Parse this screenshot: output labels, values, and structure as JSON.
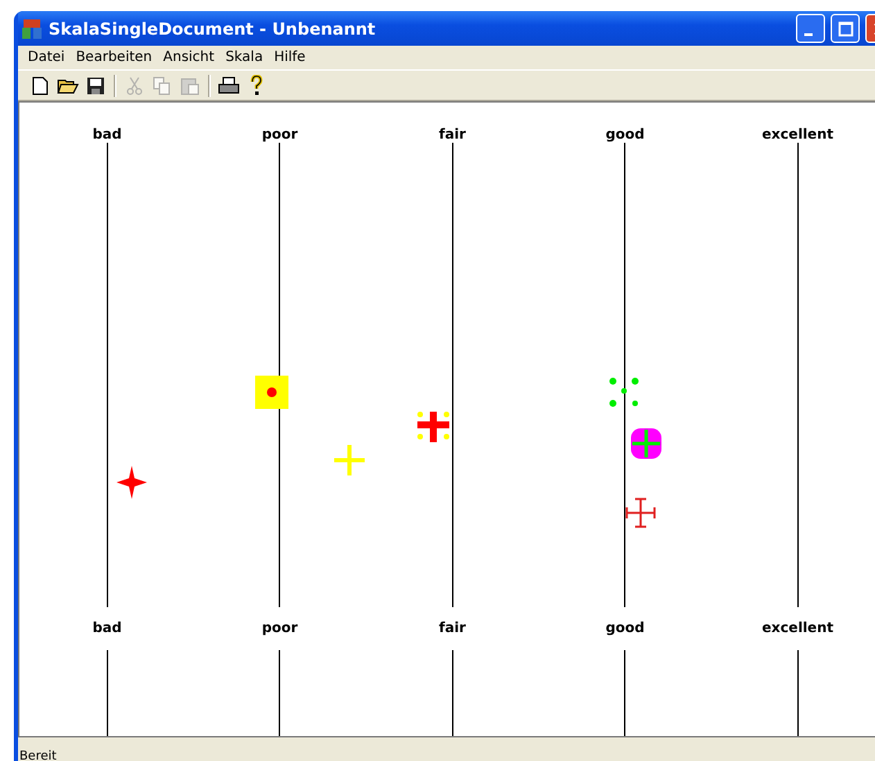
{
  "window": {
    "title": "SkalaSingleDocument - Unbenannt"
  },
  "menu": [
    "Datei",
    "Bearbeiten",
    "Ansicht",
    "Skala",
    "Hilfe"
  ],
  "toolbar": [
    {
      "kind": "new",
      "disabled": false
    },
    {
      "kind": "open",
      "disabled": false
    },
    {
      "kind": "save",
      "disabled": false
    },
    {
      "kind": "separator"
    },
    {
      "kind": "cut",
      "disabled": true
    },
    {
      "kind": "copy",
      "disabled": true
    },
    {
      "kind": "paste",
      "disabled": true
    },
    {
      "kind": "separator"
    },
    {
      "kind": "print",
      "disabled": false
    },
    {
      "kind": "help",
      "disabled": false
    }
  ],
  "scale": {
    "top_labels": [
      "bad",
      "poor",
      "fair",
      "good",
      "excellent"
    ],
    "bottom_labels": [
      "bad",
      "poor",
      "fair",
      "good",
      "excellent"
    ],
    "markers": [
      {
        "kind": "star"
      },
      {
        "kind": "square-dot"
      },
      {
        "kind": "plus"
      },
      {
        "kind": "double-cross"
      },
      {
        "kind": "dots"
      },
      {
        "kind": "rounded-cross"
      },
      {
        "kind": "i-beam-cross"
      }
    ]
  },
  "status_bar": {
    "text": "Bereit"
  }
}
